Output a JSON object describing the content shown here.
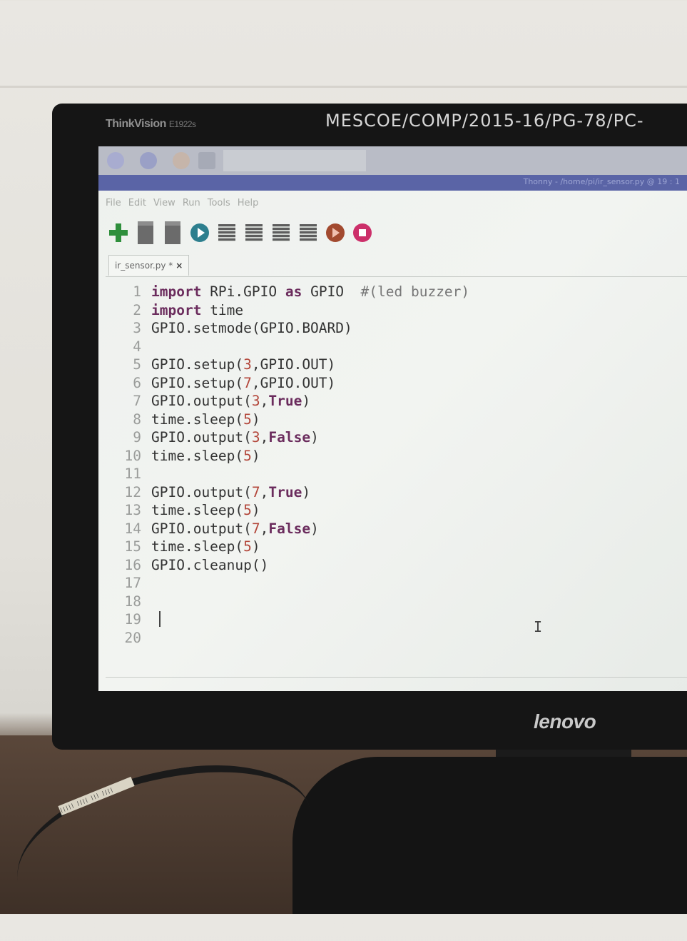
{
  "monitor": {
    "brand": "ThinkVision",
    "model": "E1922s",
    "asset_tag": "MESCOE/COMP/2015-16/PG-78/PC-",
    "maker_logo": "lenovo"
  },
  "window": {
    "title": "Thonny - /home/pi/ir_sensor.py @ 19 : 1"
  },
  "menu": [
    "File",
    "Edit",
    "View",
    "Run",
    "Tools",
    "Help"
  ],
  "toolbar": [
    {
      "name": "new-icon"
    },
    {
      "name": "open-icon"
    },
    {
      "name": "save-icon"
    },
    {
      "name": "run-icon"
    },
    {
      "name": "debug-icon"
    },
    {
      "name": "step-over-icon"
    },
    {
      "name": "step-into-icon"
    },
    {
      "name": "step-out-icon"
    },
    {
      "name": "resume-icon"
    },
    {
      "name": "stop-icon"
    }
  ],
  "tab": {
    "label": "ir_sensor.py *",
    "close": "×"
  },
  "editor": {
    "line_numbers": [
      "1",
      "2",
      "3",
      "4",
      "5",
      "6",
      "7",
      "8",
      "9",
      "10",
      "11",
      "12",
      "13",
      "14",
      "15",
      "16",
      "17",
      "18",
      "19",
      "20"
    ],
    "cursor_line": "19"
  },
  "cable_label": "||||| |||| ||| ||||"
}
